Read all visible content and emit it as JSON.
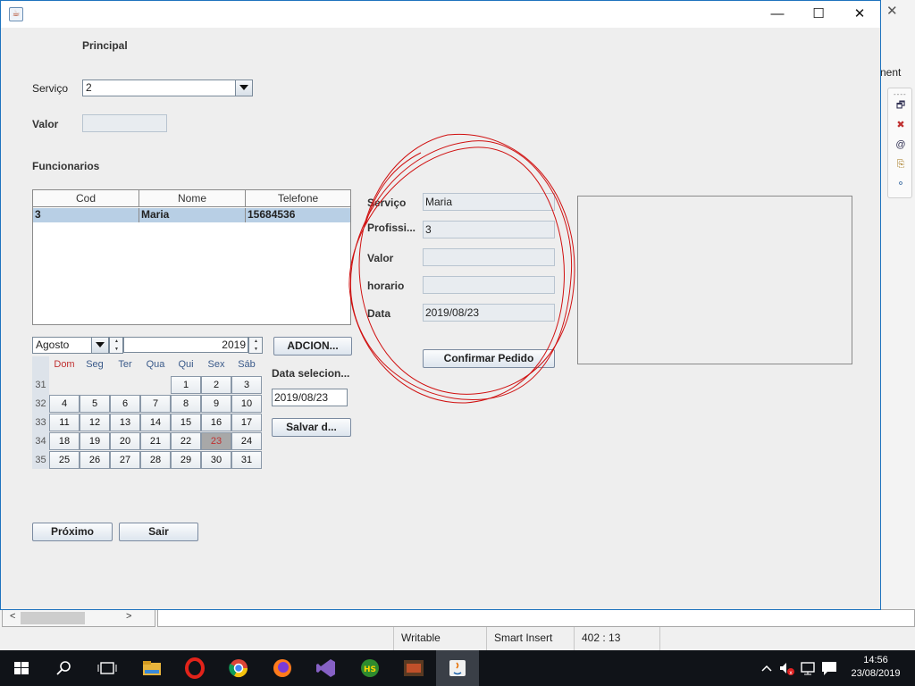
{
  "background_ide": {
    "right_text": "nent",
    "statusbar": {
      "writable": "Writable",
      "insert_mode": "Smart Insert",
      "position": "402 : 13"
    }
  },
  "window": {
    "title": "",
    "section_principal": "Principal",
    "servico_label": "Serviço",
    "servico_value": "2",
    "valor_label": "Valor",
    "valor_value": "",
    "funcionarios_label": "Funcionarios",
    "table": {
      "columns": [
        "Cod",
        "Nome",
        "Telefone"
      ],
      "rows": [
        {
          "cod": "3",
          "nome": "Maria",
          "telefone": "15684536"
        }
      ]
    },
    "calendar": {
      "month": "Agosto",
      "year": "2019",
      "weekdays": [
        "Dom",
        "Seg",
        "Ter",
        "Qua",
        "Qui",
        "Sex",
        "Sáb"
      ],
      "weeks": [
        {
          "num": "31",
          "days": [
            "",
            "",
            "",
            "",
            "1",
            "2",
            "3"
          ]
        },
        {
          "num": "32",
          "days": [
            "4",
            "5",
            "6",
            "7",
            "8",
            "9",
            "10"
          ]
        },
        {
          "num": "33",
          "days": [
            "11",
            "12",
            "13",
            "14",
            "15",
            "16",
            "17"
          ]
        },
        {
          "num": "34",
          "days": [
            "18",
            "19",
            "20",
            "21",
            "22",
            "23",
            "24"
          ]
        },
        {
          "num": "35",
          "days": [
            "25",
            "26",
            "27",
            "28",
            "29",
            "30",
            "31"
          ]
        }
      ],
      "selected_day": "23"
    },
    "adicionar_button": "ADCION...",
    "data_selecionada_label": "Data selecion...",
    "data_selecionada_value": "2019/08/23",
    "salvar_button": "Salvar d...",
    "proximo_button": "Próximo",
    "sair_button": "Sair",
    "pedido": {
      "servico_label": "Serviço",
      "servico_value": "Maria",
      "profissional_label": "Profissi...",
      "profissional_value": "3",
      "valor_label": "Valor",
      "valor_value": "",
      "horario_label": "horario",
      "horario_value": "",
      "data_label": "Data",
      "data_value": "2019/08/23",
      "confirmar_button": "Confirmar Pedido"
    },
    "annotation_color": "#d01010"
  },
  "taskbar": {
    "icons": [
      "windows-start-icon",
      "search-icon",
      "task-view-icon",
      "file-explorer-icon",
      "opera-icon",
      "chrome-icon",
      "firefox-icon",
      "visual-studio-icon",
      "hs-app-icon",
      "game-app-icon",
      "java-icon"
    ],
    "time": "14:56",
    "date": "23/08/2019"
  }
}
